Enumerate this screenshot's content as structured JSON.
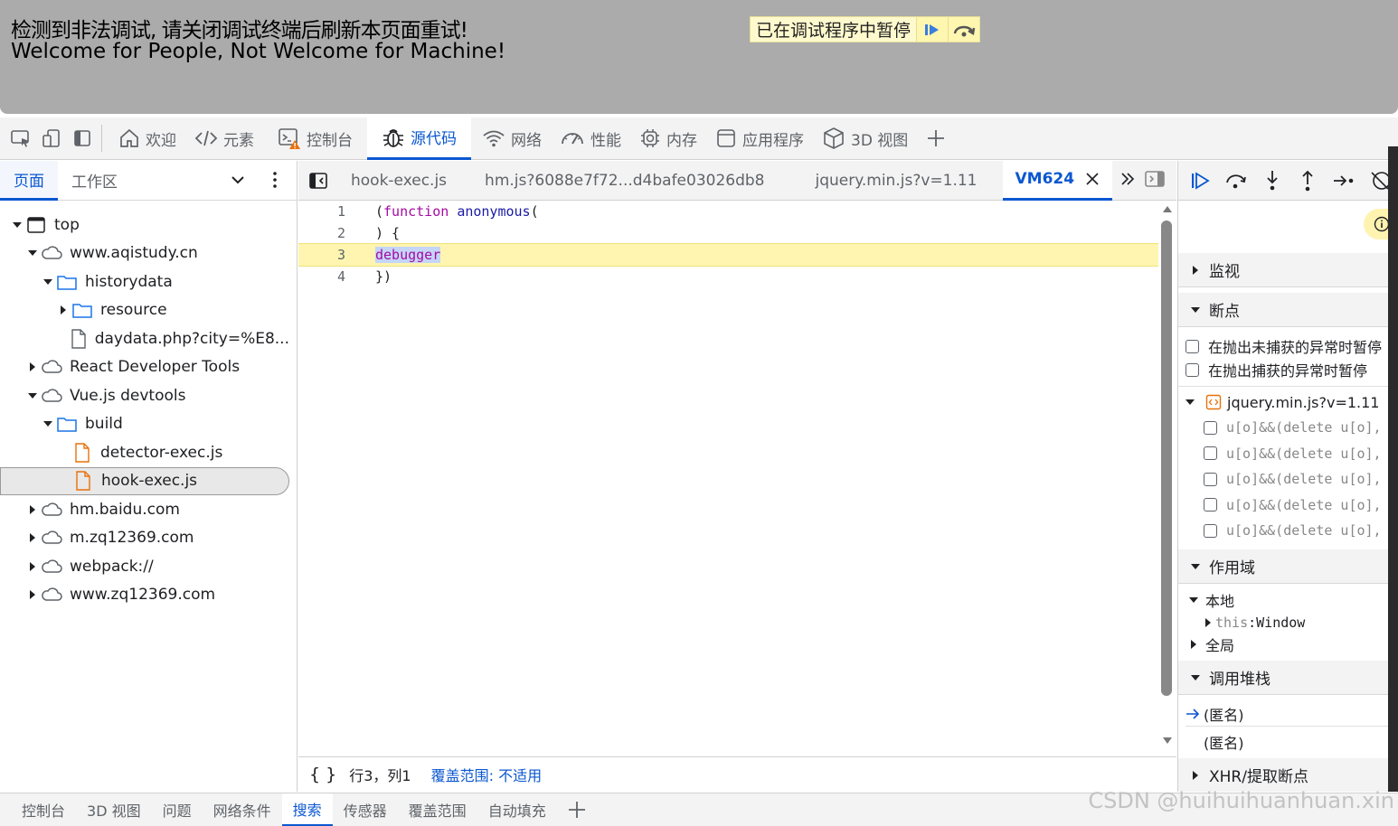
{
  "banner": {
    "line1": "检测到非法调试, 请关闭调试终端后刷新本页面重试!",
    "line2": "Welcome for People, Not Welcome for Machine!",
    "paused_label": "已在调试程序中暂停"
  },
  "main_tabs": [
    {
      "label": "欢迎",
      "icon": "home-icon"
    },
    {
      "label": "元素",
      "icon": "code-icon"
    },
    {
      "label": "控制台",
      "icon": "console-icon"
    },
    {
      "label": "源代码",
      "icon": "bug-icon"
    },
    {
      "label": "网络",
      "icon": "wifi-icon"
    },
    {
      "label": "性能",
      "icon": "gauge-icon"
    },
    {
      "label": "内存",
      "icon": "chip-icon"
    },
    {
      "label": "应用程序",
      "icon": "app-icon"
    },
    {
      "label": "3D 视图",
      "icon": "cube-icon"
    }
  ],
  "navigator": {
    "tabs": [
      "页面",
      "工作区"
    ],
    "tree": [
      {
        "label": "top",
        "type": "frame",
        "depth": 0,
        "expanded": true
      },
      {
        "label": "www.aqistudy.cn",
        "type": "cloud",
        "depth": 1,
        "expanded": true
      },
      {
        "label": "historydata",
        "type": "folder",
        "depth": 2,
        "expanded": true
      },
      {
        "label": "resource",
        "type": "folder",
        "depth": 3,
        "expanded": false
      },
      {
        "label": "daydata.php?city=%E8...",
        "type": "file",
        "depth": 3
      },
      {
        "label": "React Developer Tools",
        "type": "cloud",
        "depth": 1,
        "expanded": false
      },
      {
        "label": "Vue.js devtools",
        "type": "cloud",
        "depth": 1,
        "expanded": true
      },
      {
        "label": "build",
        "type": "folder",
        "depth": 2,
        "expanded": true
      },
      {
        "label": "detector-exec.js",
        "type": "jsfile",
        "depth": 3
      },
      {
        "label": "hook-exec.js",
        "type": "jsfile",
        "depth": 3,
        "selected": true
      },
      {
        "label": "hm.baidu.com",
        "type": "cloud",
        "depth": 1,
        "expanded": false
      },
      {
        "label": "m.zq12369.com",
        "type": "cloud",
        "depth": 1,
        "expanded": false
      },
      {
        "label": "webpack://",
        "type": "cloud",
        "depth": 1,
        "expanded": false
      },
      {
        "label": "www.zq12369.com",
        "type": "cloud",
        "depth": 1,
        "expanded": false
      }
    ]
  },
  "editor": {
    "tabs": [
      "hook-exec.js",
      "hm.js?6088e7f72...d4bafe03026db8",
      "jquery.min.js?v=1.11",
      "VM624"
    ],
    "lines": [
      {
        "no": "1",
        "parts": [
          [
            "",
            "("
          ],
          [
            "kw",
            "function"
          ],
          [
            "",
            " "
          ],
          [
            "fn",
            "anonymous"
          ],
          [
            "",
            "("
          ]
        ]
      },
      {
        "no": "2",
        "parts": [
          [
            "",
            ") {"
          ]
        ]
      },
      {
        "no": "3",
        "parts": [
          [
            "dbg",
            "debugger"
          ]
        ],
        "highlight": true
      },
      {
        "no": "4",
        "parts": [
          [
            "",
            "})"
          ]
        ]
      }
    ],
    "status_position": "行3，列1",
    "status_coverage": "覆盖范围: 不适用"
  },
  "right_panel": {
    "watch": "监视",
    "breakpoints": "断点",
    "pause_uncaught": "在抛出未捕获的异常时暂停",
    "pause_caught": "在抛出捕获的异常时暂停",
    "bp_file": "jquery.min.js?v=1.11",
    "bp_items": [
      "u[o]&&(delete u[o],",
      "u[o]&&(delete u[o],",
      "u[o]&&(delete u[o],",
      "u[o]&&(delete u[o],",
      "u[o]&&(delete u[o],"
    ],
    "scope": "作用域",
    "local": "本地",
    "this_key": "this",
    "this_val": "Window",
    "global": "全局",
    "call_stack": "调用堆栈",
    "frames": [
      "(匿名)",
      "(匿名)"
    ],
    "xhr": "XHR/提取断点"
  },
  "drawer_tabs": [
    "控制台",
    "3D 视图",
    "问题",
    "网络条件",
    "搜索",
    "传感器",
    "覆盖范围",
    "自动填充"
  ],
  "drawer_active": "搜索",
  "watermark": "CSDN @huihuihuanhuan.xin",
  "colors": {
    "accent": "#0b57d0",
    "highlight": "#fff5b0",
    "banner": "#ababab"
  }
}
